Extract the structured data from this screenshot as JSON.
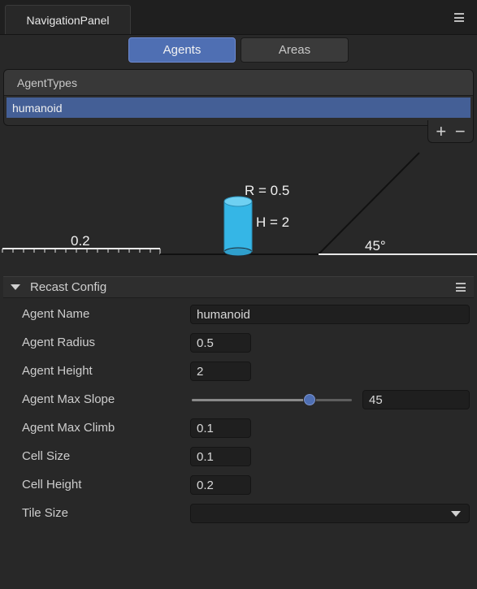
{
  "tab": {
    "title": "NavigationPanel"
  },
  "mode_buttons": {
    "agents": "Agents",
    "areas": "Areas"
  },
  "agent_types": {
    "header": "AgentTypes",
    "items": [
      "humanoid"
    ],
    "add_glyph": "+",
    "remove_glyph": "−"
  },
  "diagram": {
    "radius_label": "R = 0.5",
    "height_label": "H = 2",
    "step_label": "0.2",
    "slope_label": "45°",
    "agent_color": "#35b6e6"
  },
  "recast_config": {
    "title": "Recast Config",
    "fields": {
      "agent_name": {
        "label": "Agent Name",
        "value": "humanoid"
      },
      "agent_radius": {
        "label": "Agent Radius",
        "value": "0.5"
      },
      "agent_height": {
        "label": "Agent Height",
        "value": "2"
      },
      "agent_max_slope": {
        "label": "Agent Max Slope",
        "value": "45",
        "slider_fraction": 0.73
      },
      "agent_max_climb": {
        "label": "Agent Max Climb",
        "value": "0.1"
      },
      "cell_size": {
        "label": "Cell Size",
        "value": "0.1"
      },
      "cell_height": {
        "label": "Cell Height",
        "value": "0.2"
      },
      "tile_size": {
        "label": "Tile Size",
        "value": ""
      }
    }
  },
  "colors": {
    "accent": "#4f6fb3",
    "selection": "#445f96",
    "background": "#282828"
  }
}
